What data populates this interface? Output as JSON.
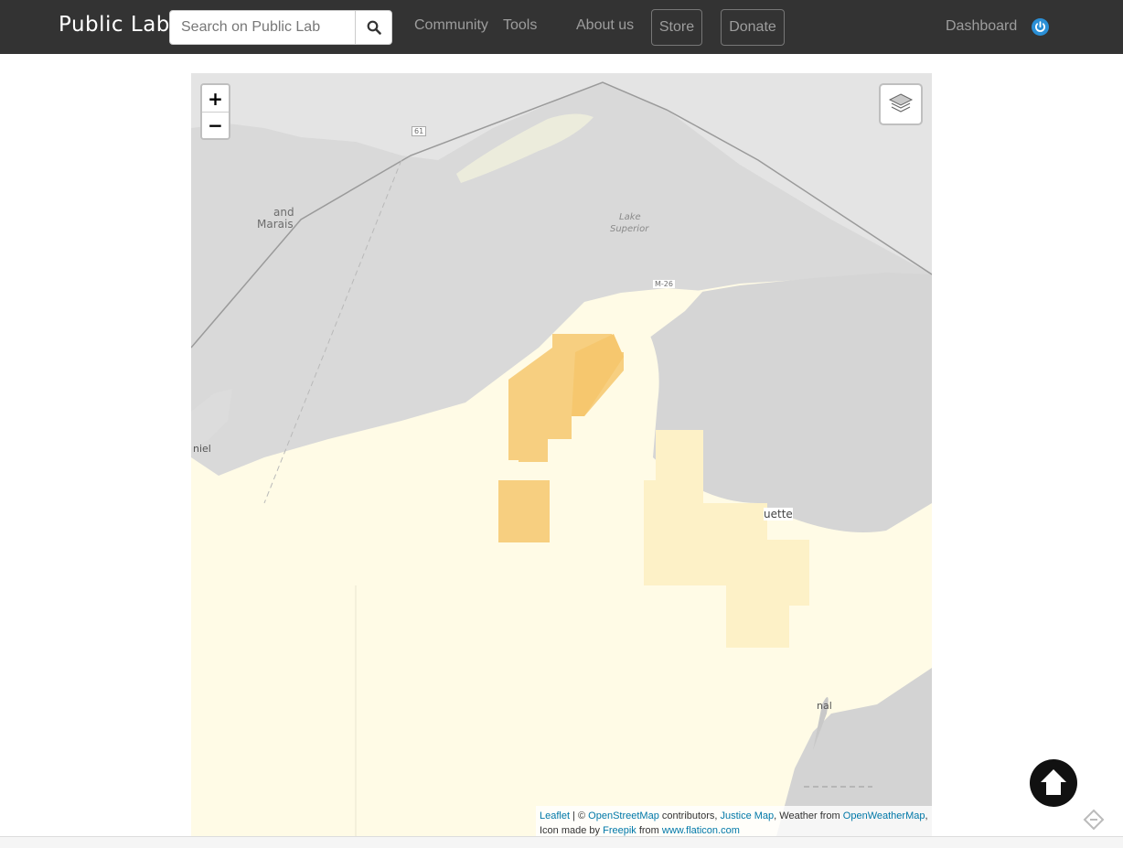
{
  "navbar": {
    "brand": "Public Lab",
    "search_placeholder": "Search on Public Lab",
    "links": {
      "community": "Community",
      "tools": "Tools",
      "about": "About us",
      "store": "Store",
      "donate": "Donate",
      "dashboard": "Dashboard"
    }
  },
  "map": {
    "zoom_in": "+",
    "zoom_out": "−",
    "labels": {
      "grand_marais_top": "and",
      "grand_marais": "Marais",
      "lake": "Lake",
      "superior": "Superior",
      "road_61": "61",
      "road_m26": "M-26",
      "marquette": "uette",
      "bottom_left": "niel",
      "bottom_right": "nal"
    },
    "icons": [
      "plus-icon",
      "minus-icon",
      "layers-icon",
      "search-icon",
      "power-icon",
      "arrow-up-circle-icon",
      "tag-icon"
    ]
  },
  "attribution": {
    "leaflet": "Leaflet",
    "sep": " | © ",
    "osm": "OpenStreetMap",
    "contrib": " contributors, ",
    "justice": "Justice Map",
    "weather": ", Weather from ",
    "owm": "OpenWeatherMap",
    "comma": ",",
    "icon_by": "Icon made by ",
    "freepik": "Freepik",
    "from": " from ",
    "flaticon": "www.flaticon.com"
  }
}
